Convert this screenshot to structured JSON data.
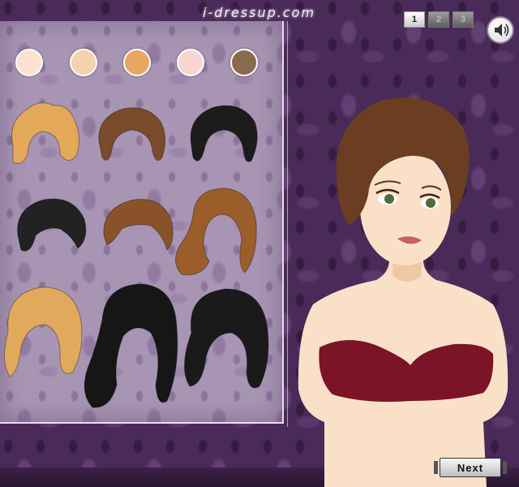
{
  "header": {
    "logo_text": "i-dressup.com"
  },
  "pagination": {
    "pages": [
      "1",
      "2",
      "3"
    ],
    "active": "1"
  },
  "sound_button": {
    "icon": "speaker-icon"
  },
  "skin_tones": [
    {
      "name": "skin-tone-porcelain",
      "color": "#fbe2d0"
    },
    {
      "name": "skin-tone-light",
      "color": "#f3d3ad"
    },
    {
      "name": "skin-tone-tan",
      "color": "#e8a766"
    },
    {
      "name": "skin-tone-pink",
      "color": "#fad6d2"
    },
    {
      "name": "skin-tone-brown",
      "color": "#8a6b4e"
    }
  ],
  "hairstyles": [
    {
      "name": "hairstyle-blonde-short",
      "color": "#e3a85a"
    },
    {
      "name": "hairstyle-brown-pixie",
      "color": "#7a4b2a"
    },
    {
      "name": "hairstyle-black-updo",
      "color": "#1c1c1c"
    },
    {
      "name": "hairstyle-black-bun",
      "color": "#222222"
    },
    {
      "name": "hairstyle-brown-waves",
      "color": "#8a5228"
    },
    {
      "name": "hairstyle-brown-curly-side",
      "color": "#9b5d2a"
    },
    {
      "name": "hairstyle-blonde-curls",
      "color": "#e0a95c"
    },
    {
      "name": "hairstyle-black-long-curly",
      "color": "#161616"
    },
    {
      "name": "hairstyle-black-long-wavy",
      "color": "#1a1a1a"
    }
  ],
  "model": {
    "hair_color": "#6b3e22",
    "skin_color": "#fbe0c8",
    "top_color": "#7a1426"
  },
  "footer": {
    "next_label": "Next"
  }
}
